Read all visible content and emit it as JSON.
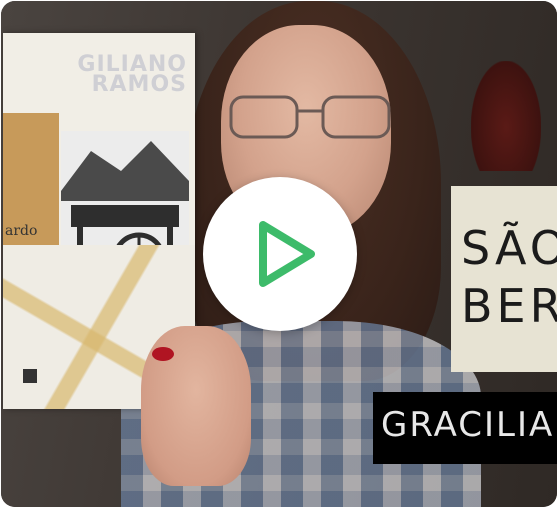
{
  "video": {
    "book_author": "GILIANO RAMOS",
    "book_title": "ardo",
    "sign_line1": "SÃO",
    "sign_line2": "BER",
    "caption": "GRACILIA"
  },
  "play_button": {
    "icon": "play-icon",
    "color": "#3dbb6a"
  }
}
